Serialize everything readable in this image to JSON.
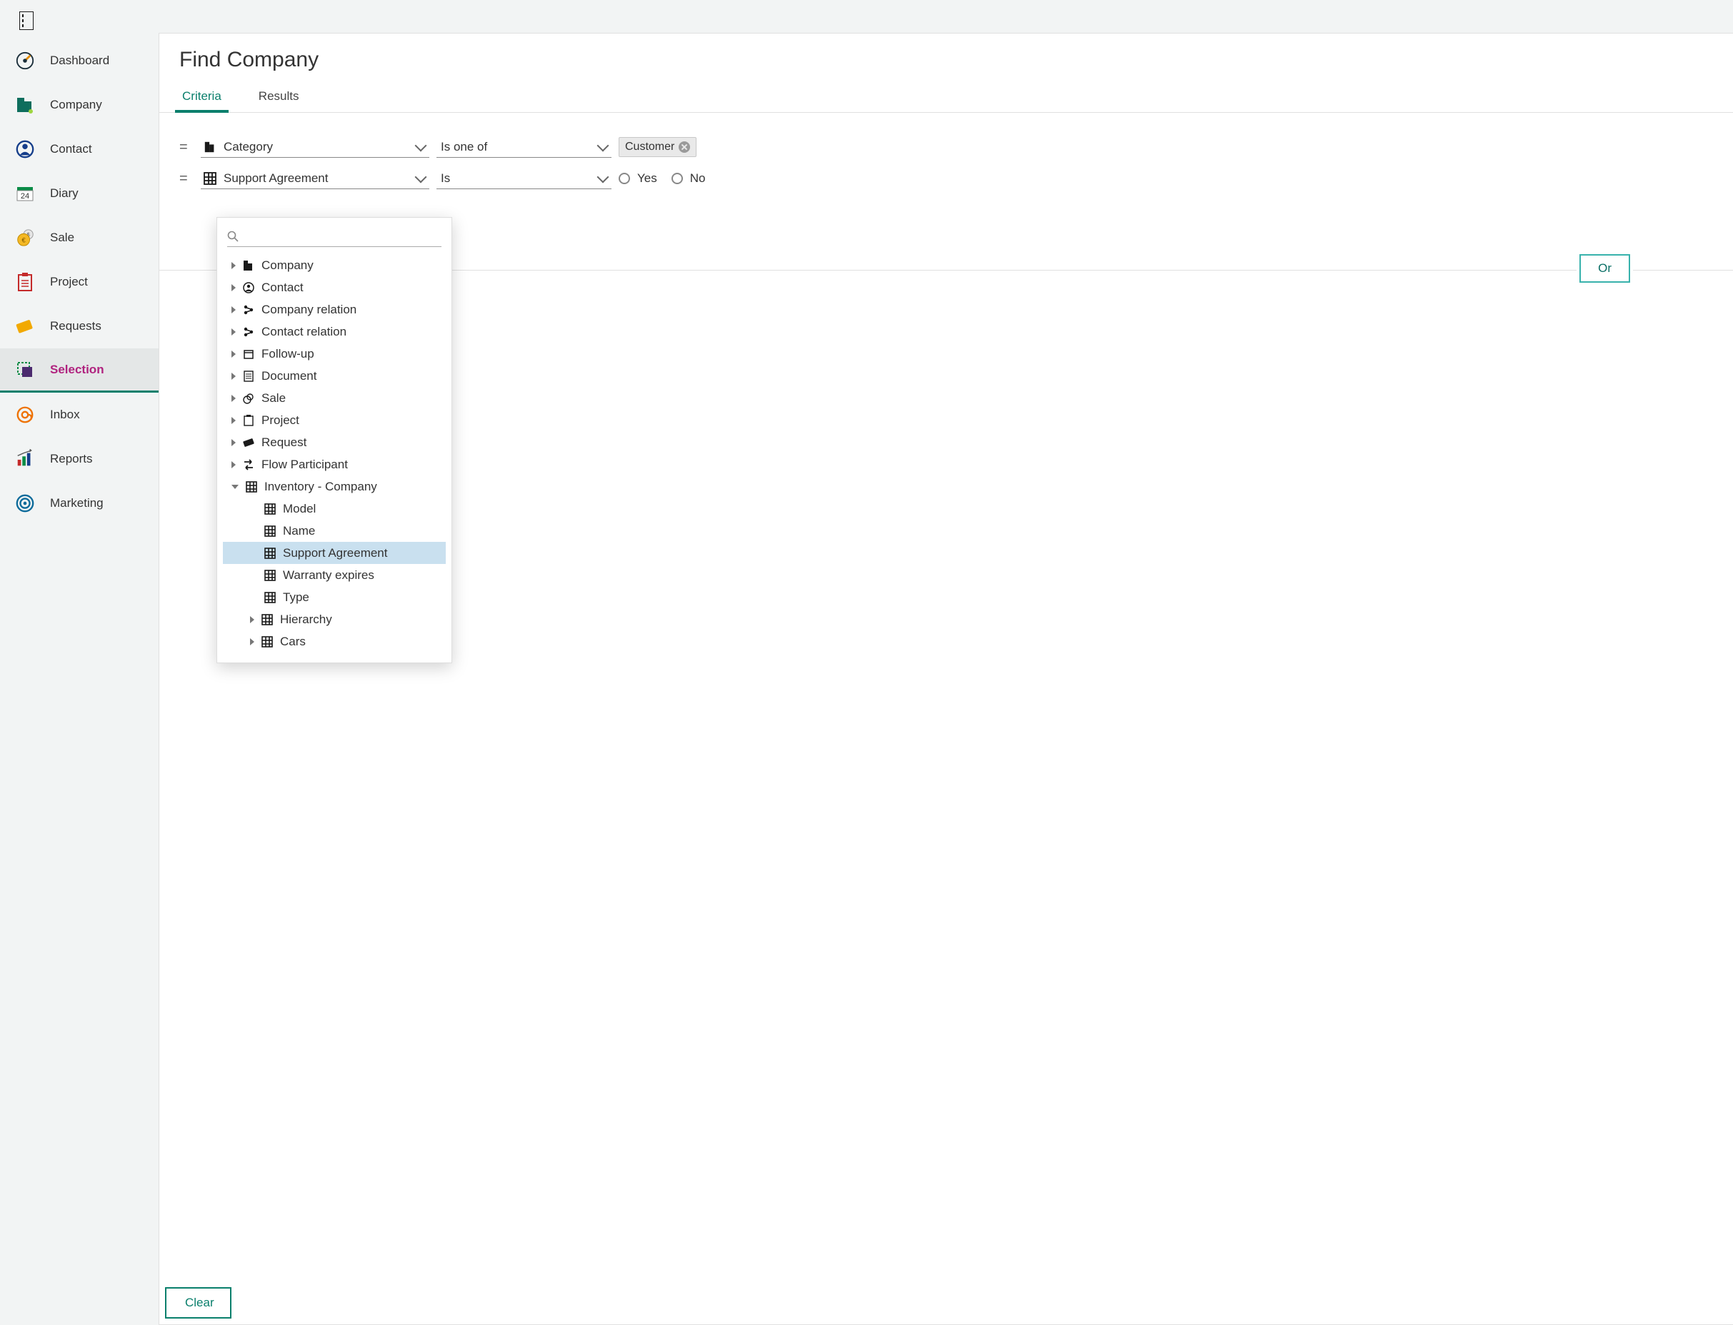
{
  "sidebar": {
    "items": [
      {
        "label": "Dashboard"
      },
      {
        "label": "Company"
      },
      {
        "label": "Contact"
      },
      {
        "label": "Diary"
      },
      {
        "label": "Sale"
      },
      {
        "label": "Project"
      },
      {
        "label": "Requests"
      },
      {
        "label": "Selection"
      },
      {
        "label": "Inbox"
      },
      {
        "label": "Reports"
      },
      {
        "label": "Marketing"
      }
    ]
  },
  "main": {
    "title": "Find Company",
    "tabs": [
      {
        "label": "Criteria"
      },
      {
        "label": "Results"
      }
    ],
    "criteria": [
      {
        "eq": "=",
        "field": "Category",
        "op": "Is one of",
        "tag": "Customer"
      },
      {
        "eq": "=",
        "field": "Support Agreement",
        "op": "Is",
        "radio_yes": "Yes",
        "radio_no": "No"
      }
    ],
    "or_label": "Or",
    "clear_label": "Clear"
  },
  "dropdown": {
    "search_placeholder": "",
    "items": [
      {
        "label": "Company"
      },
      {
        "label": "Contact"
      },
      {
        "label": "Company relation"
      },
      {
        "label": "Contact relation"
      },
      {
        "label": "Follow-up"
      },
      {
        "label": "Document"
      },
      {
        "label": "Sale"
      },
      {
        "label": "Project"
      },
      {
        "label": "Request"
      },
      {
        "label": "Flow Participant"
      },
      {
        "label": "Inventory - Company"
      }
    ],
    "children": [
      {
        "label": "Model"
      },
      {
        "label": "Name"
      },
      {
        "label": "Support Agreement"
      },
      {
        "label": "Warranty expires"
      },
      {
        "label": "Type"
      }
    ],
    "sub2": [
      {
        "label": "Hierarchy"
      },
      {
        "label": "Cars"
      }
    ]
  }
}
